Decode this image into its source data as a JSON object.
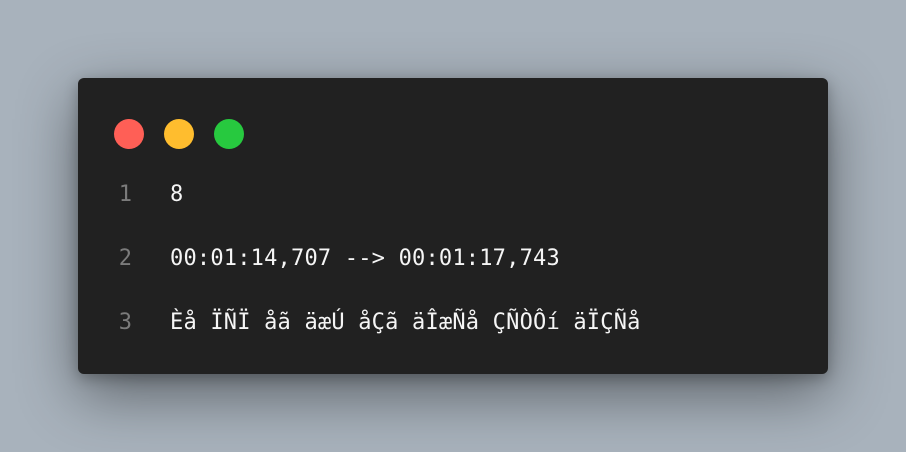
{
  "window": {
    "controls": [
      {
        "name": "close",
        "color": "#ff5f56"
      },
      {
        "name": "minimize",
        "color": "#ffbd2e"
      },
      {
        "name": "zoom",
        "color": "#27c93f"
      }
    ],
    "lines": [
      {
        "number": "1",
        "text": "8"
      },
      {
        "number": "2",
        "text": "00:01:14,707 --> 00:01:17,743"
      },
      {
        "number": "3",
        "text": "Èå ÏÑÏ åã äæÚ åÇã äÎæÑå ÇÑÒÔí äÏÇÑå"
      }
    ]
  }
}
